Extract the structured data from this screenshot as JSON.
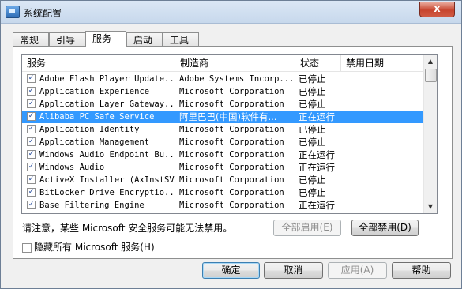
{
  "window": {
    "title": "系统配置",
    "close_label": "x"
  },
  "tabs": [
    {
      "label": "常规",
      "active": false
    },
    {
      "label": "引导",
      "active": false
    },
    {
      "label": "服务",
      "active": true
    },
    {
      "label": "启动",
      "active": false
    },
    {
      "label": "工具",
      "active": false
    }
  ],
  "table": {
    "headers": {
      "name": "服务",
      "vendor": "制造商",
      "status": "状态",
      "disabled_date": "禁用日期"
    },
    "rows": [
      {
        "checked": true,
        "name": "Adobe Flash Player Update...",
        "vendor": "Adobe Systems Incorp...",
        "status": "已停止",
        "selected": false
      },
      {
        "checked": true,
        "name": "Application Experience",
        "vendor": "Microsoft Corporation",
        "status": "已停止",
        "selected": false
      },
      {
        "checked": true,
        "name": "Application Layer Gateway...",
        "vendor": "Microsoft Corporation",
        "status": "已停止",
        "selected": false
      },
      {
        "checked": true,
        "name": "Alibaba PC Safe Service",
        "vendor": "阿里巴巴(中国)软件有...",
        "status": "正在运行",
        "selected": true
      },
      {
        "checked": true,
        "name": "Application Identity",
        "vendor": "Microsoft Corporation",
        "status": "已停止",
        "selected": false
      },
      {
        "checked": true,
        "name": "Application Management",
        "vendor": "Microsoft Corporation",
        "status": "已停止",
        "selected": false
      },
      {
        "checked": true,
        "name": "Windows Audio Endpoint Bu...",
        "vendor": "Microsoft Corporation",
        "status": "正在运行",
        "selected": false
      },
      {
        "checked": true,
        "name": "Windows Audio",
        "vendor": "Microsoft Corporation",
        "status": "正在运行",
        "selected": false
      },
      {
        "checked": true,
        "name": "ActiveX Installer (AxInstSV)",
        "vendor": "Microsoft Corporation",
        "status": "已停止",
        "selected": false
      },
      {
        "checked": true,
        "name": "BitLocker Drive Encryptio...",
        "vendor": "Microsoft Corporation",
        "status": "已停止",
        "selected": false
      },
      {
        "checked": true,
        "name": "Base Filtering Engine",
        "vendor": "Microsoft Corporation",
        "status": "正在运行",
        "selected": false
      }
    ]
  },
  "note": "请注意，某些 Microsoft 安全服务可能无法禁用。",
  "buttons": {
    "enable_all": "全部启用(E)",
    "disable_all": "全部禁用(D)",
    "ok": "确定",
    "cancel": "取消",
    "apply": "应用(A)",
    "help": "帮助"
  },
  "hide_ms_label": "隐藏所有 Microsoft 服务(H)",
  "colors": {
    "selection": "#3399ff",
    "close_button": "#c7452f"
  }
}
